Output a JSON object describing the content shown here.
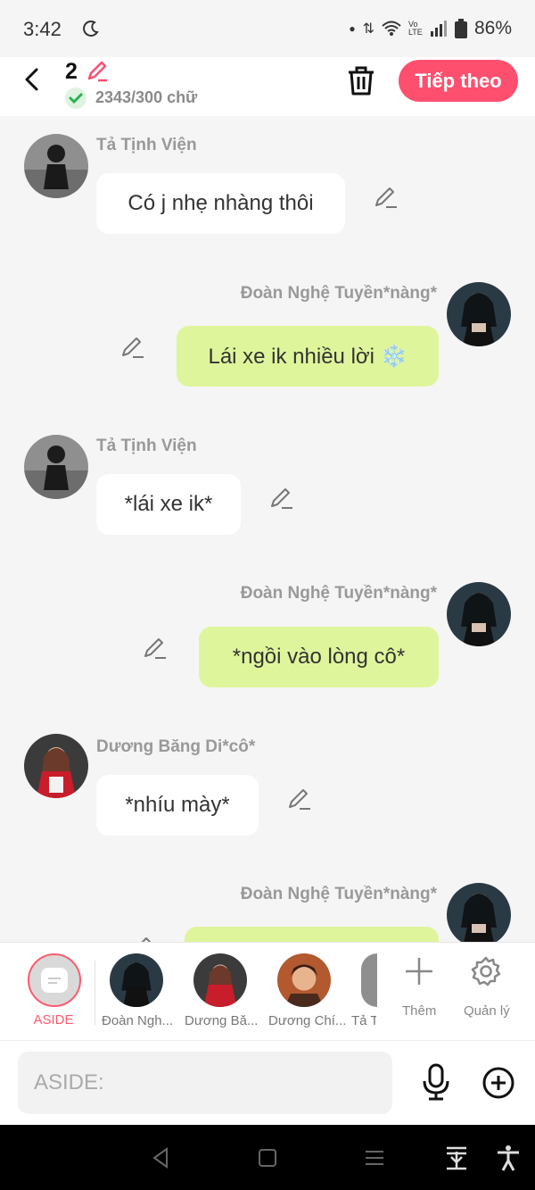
{
  "status": {
    "time": "3:42",
    "battery": "86%",
    "lte": "Vo LTE"
  },
  "header": {
    "count": "2",
    "words": "2343/300 chữ",
    "next_label": "Tiếp theo"
  },
  "messages": [
    {
      "side": "left",
      "name": "Tả Tịnh Viện",
      "text": "Có j nhẹ nhàng thôi"
    },
    {
      "side": "right",
      "name": "Đoàn Nghệ Tuyền*nàng*",
      "text": "Lái xe ik nhiều lời ❄️"
    },
    {
      "side": "left",
      "name": "Tả Tịnh Viện",
      "text": "*lái xe ik*"
    },
    {
      "side": "right",
      "name": "Đoàn Nghệ Tuyền*nàng*",
      "text": "*ngồi vào lòng cô*"
    },
    {
      "side": "left",
      "name": "Dương Băng Di*cô*",
      "text": "*nhíu mày*"
    },
    {
      "side": "right",
      "name": "Đoàn Nghệ Tuyền*nàng*",
      "text": ""
    }
  ],
  "characters": {
    "aside_label": "ASIDE",
    "items": [
      {
        "label": "Đoàn Ngh..."
      },
      {
        "label": "Dương Bă..."
      },
      {
        "label": "Dương Chí..."
      },
      {
        "label": "Tả T"
      }
    ],
    "add_label": "Thêm",
    "manage_label": "Quản lý"
  },
  "composer": {
    "placeholder": "ASIDE:"
  },
  "colors": {
    "accent": "#ff4f6f",
    "bubble_right": "#dff59b",
    "bubble_left": "#ffffff"
  }
}
